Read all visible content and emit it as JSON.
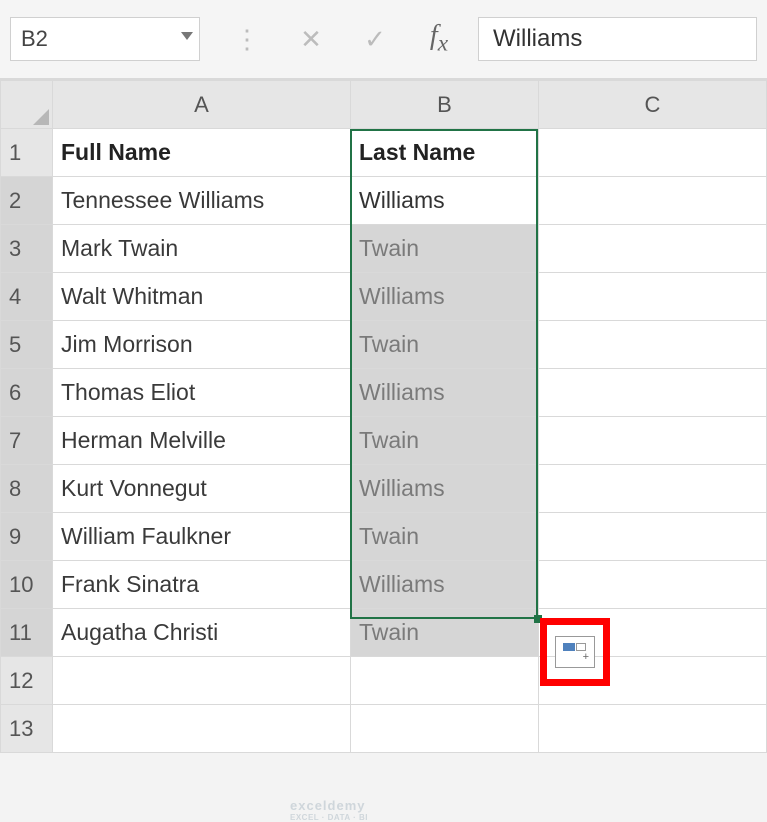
{
  "formula_bar": {
    "name_box": "B2",
    "formula_value": "Williams"
  },
  "columns": {
    "A": "A",
    "B": "B",
    "C": "C"
  },
  "header_row": {
    "A": "Full Name",
    "B": "Last Name"
  },
  "rows": [
    {
      "n": "1"
    },
    {
      "n": "2",
      "A": "Tennessee Williams",
      "B": "Williams"
    },
    {
      "n": "3",
      "A": "Mark Twain",
      "B": "Twain"
    },
    {
      "n": "4",
      "A": "Walt Whitman",
      "B": "Williams"
    },
    {
      "n": "5",
      "A": "Jim Morrison",
      "B": "Twain"
    },
    {
      "n": "6",
      "A": "Thomas Eliot",
      "B": "Williams"
    },
    {
      "n": "7",
      "A": "Herman Melville",
      "B": "Twain"
    },
    {
      "n": "8",
      "A": "Kurt Vonnegut",
      "B": "Williams"
    },
    {
      "n": "9",
      "A": "William Faulkner",
      "B": "Twain"
    },
    {
      "n": "10",
      "A": "Frank Sinatra",
      "B": "Williams"
    },
    {
      "n": "11",
      "A": "Augatha Christi",
      "B": "Twain"
    },
    {
      "n": "12"
    },
    {
      "n": "13"
    }
  ],
  "watermark": {
    "brand": "exceldemy",
    "tagline": "EXCEL · DATA · BI"
  },
  "selection": {
    "range": "B2:B11",
    "active_cell": "B2"
  }
}
